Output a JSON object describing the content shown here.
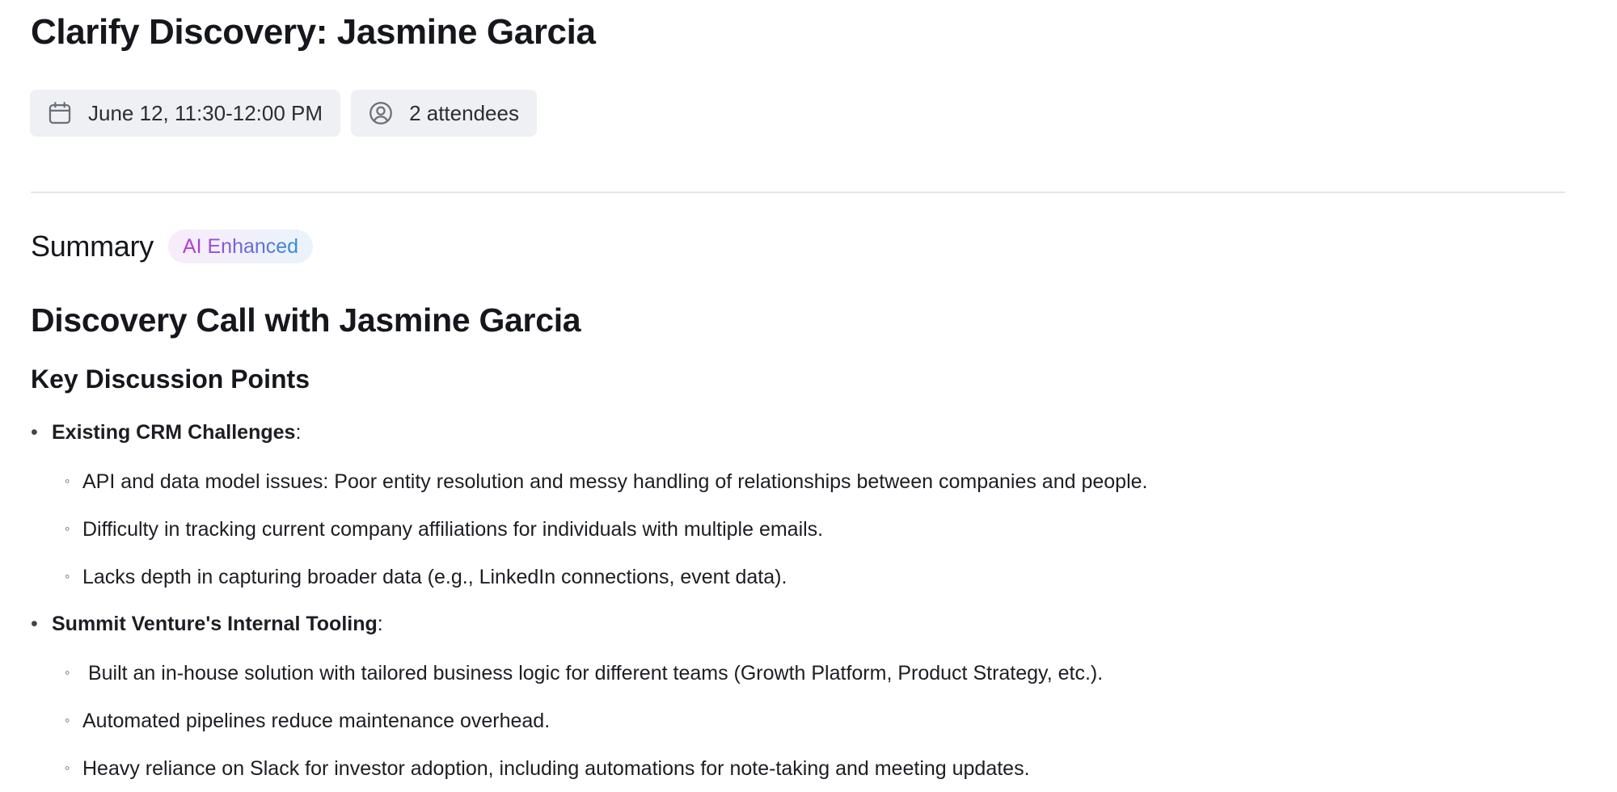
{
  "meeting": {
    "title": "Clarify Discovery: Jasmine Garcia",
    "date_chip": {
      "icon": "calendar-icon",
      "label": "June 12, 11:30-12:00 PM"
    },
    "attendees_chip": {
      "icon": "user-circle-icon",
      "label": "2 attendees"
    }
  },
  "summary": {
    "label": "Summary",
    "badge": "AI Enhanced",
    "heading": "Discovery Call with Jasmine Garcia",
    "subheading": "Key Discussion Points",
    "sections": [
      {
        "title": "Existing CRM Challenges",
        "suffix": ":",
        "points": [
          "API and data model issues: Poor entity resolution and messy handling of relationships between companies and people.",
          "Difficulty in tracking current company affiliations for individuals with multiple emails.",
          "Lacks depth in capturing broader data (e.g., LinkedIn connections, event data)."
        ]
      },
      {
        "title": "Summit Venture's Internal Tooling",
        "suffix": ":",
        "points": [
          " Built an in-house solution with tailored business logic for different teams (Growth Platform, Product Strategy, etc.).",
          "Automated pipelines reduce maintenance overhead.",
          "Heavy reliance on Slack for investor adoption, including automations for note-taking and meeting updates."
        ]
      }
    ]
  },
  "colors": {
    "chip_background": "#eef0f3",
    "divider": "#e4e6ea",
    "badge_gradient_start": "#b63ad4",
    "badge_gradient_end": "#2f8ed8"
  }
}
